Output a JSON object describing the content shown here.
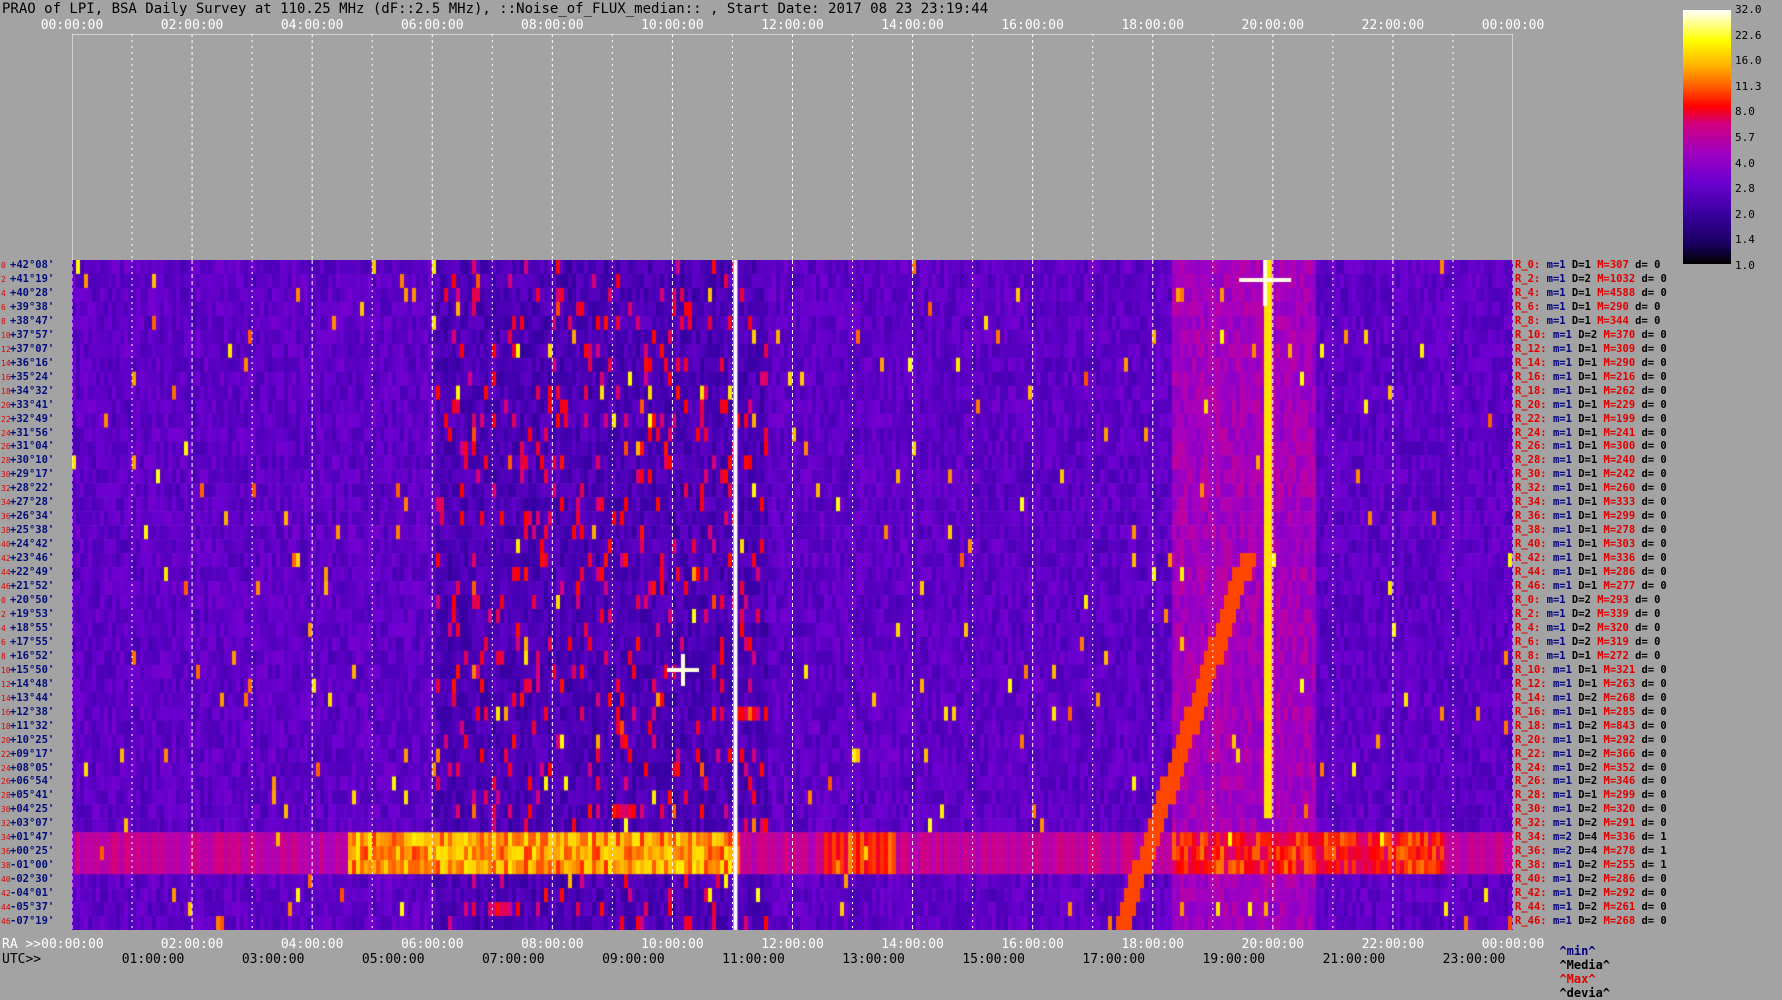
{
  "header": {
    "title": "PRAO of LPI, BSA Daily Survey at 110.25 MHz (dF::2.5 MHz), ::Noise_of_FLUX_median:: , Start Date: 2017 08 23 23:19:44"
  },
  "top_axis": {
    "ticks": [
      "00:00:00",
      "02:00:00",
      "04:00:00",
      "06:00:00",
      "08:00:00",
      "10:00:00",
      "12:00:00",
      "14:00:00",
      "16:00:00",
      "18:00:00",
      "20:00:00",
      "22:00:00",
      "00:00:00"
    ]
  },
  "bottom_axis": {
    "ra_label": "RA >>00:00:00",
    "ra_ticks": [
      "02:00:00",
      "04:00:00",
      "06:00:00",
      "08:00:00",
      "10:00:00",
      "12:00:00",
      "14:00:00",
      "16:00:00",
      "18:00:00",
      "20:00:00",
      "22:00:00",
      "00:00:00"
    ],
    "utc_label": "UTC>>",
    "utc_ticks": [
      "01:00:00",
      "03:00:00",
      "05:00:00",
      "07:00:00",
      "09:00:00",
      "11:00:00",
      "13:00:00",
      "15:00:00",
      "17:00:00",
      "19:00:00",
      "21:00:00",
      "23:00:00"
    ]
  },
  "stats_key": {
    "min": "^min^",
    "median": "^Media^",
    "max": "^Max^",
    "devia": "^devia^"
  },
  "chart_data": {
    "type": "heatmap",
    "colorbar": {
      "ticks": [
        "32.0",
        "22.6",
        "16.0",
        "11.3",
        "8.0",
        "5.7",
        "4.0",
        "2.8",
        "2.0",
        "1.4",
        "1.0"
      ],
      "colors": [
        "#000000",
        "#3a00a0",
        "#a000c0",
        "#ff0000",
        "#ffb000",
        "#ffff00",
        "#ffffff"
      ]
    },
    "declinations": [
      "+42°08'",
      "+41°19'",
      "+40°28'",
      "+39°38'",
      "+38°47'",
      "+37°57'",
      "+37°07'",
      "+36°16'",
      "+35°24'",
      "+34°32'",
      "+33°41'",
      "+32°49'",
      "+31°56'",
      "+31°04'",
      "+30°10'",
      "+29°17'",
      "+28°22'",
      "+27°28'",
      "+26°34'",
      "+25°38'",
      "+24°42'",
      "+23°46'",
      "+22°49'",
      "+21°52'",
      "+20°50'",
      "+19°53'",
      "+18°55'",
      "+17°55'",
      "+16°52'",
      "+15°50'",
      "+14°48'",
      "+13°44'",
      "+12°38'",
      "+11°32'",
      "+10°25'",
      "+09°17'",
      "+08°05'",
      "+06°54'",
      "+05°41'",
      "+04°25'",
      "+03°07'",
      "+01°47'",
      "+00°25'",
      "-01°00'",
      "-02°30'",
      "-04°01'",
      "-05°37'",
      "-07°19'"
    ],
    "beam_indices": [
      "0",
      "2",
      "4",
      "6",
      "8",
      "10",
      "12",
      "14",
      "16",
      "18",
      "20",
      "22",
      "24",
      "26",
      "28",
      "30",
      "32",
      "34",
      "36",
      "38",
      "40",
      "42",
      "44",
      "46",
      "0",
      "2",
      "4",
      "6",
      "8",
      "10",
      "12",
      "14",
      "16",
      "18",
      "20",
      "22",
      "24",
      "26",
      "28",
      "30",
      "32",
      "34",
      "36",
      "38",
      "40",
      "42",
      "44",
      "46"
    ],
    "row_stats": [
      {
        "r": "R_0:",
        "m": "m=1",
        "d": "D=1",
        "x": "M=307",
        "z": "d= 0"
      },
      {
        "r": "R_2:",
        "m": "m=1",
        "d": "D=2",
        "x": "M=1032",
        "z": "d= 0"
      },
      {
        "r": "R_4:",
        "m": "m=1",
        "d": "D=1",
        "x": "M=4588",
        "z": "d= 0"
      },
      {
        "r": "R_6:",
        "m": "m=1",
        "d": "D=1",
        "x": "M=290",
        "z": "d= 0"
      },
      {
        "r": "R_8:",
        "m": "m=1",
        "d": "D=1",
        "x": "M=344",
        "z": "d= 0"
      },
      {
        "r": "R_10:",
        "m": "m=1",
        "d": "D=2",
        "x": "M=370",
        "z": "d= 0"
      },
      {
        "r": "R_12:",
        "m": "m=1",
        "d": "D=1",
        "x": "M=309",
        "z": "d= 0"
      },
      {
        "r": "R_14:",
        "m": "m=1",
        "d": "D=1",
        "x": "M=290",
        "z": "d= 0"
      },
      {
        "r": "R_16:",
        "m": "m=1",
        "d": "D=1",
        "x": "M=216",
        "z": "d= 0"
      },
      {
        "r": "R_18:",
        "m": "m=1",
        "d": "D=1",
        "x": "M=262",
        "z": "d= 0"
      },
      {
        "r": "R_20:",
        "m": "m=1",
        "d": "D=1",
        "x": "M=229",
        "z": "d= 0"
      },
      {
        "r": "R_22:",
        "m": "m=1",
        "d": "D=1",
        "x": "M=199",
        "z": "d= 0"
      },
      {
        "r": "R_24:",
        "m": "m=1",
        "d": "D=1",
        "x": "M=241",
        "z": "d= 0"
      },
      {
        "r": "R_26:",
        "m": "m=1",
        "d": "D=1",
        "x": "M=300",
        "z": "d= 0"
      },
      {
        "r": "R_28:",
        "m": "m=1",
        "d": "D=1",
        "x": "M=240",
        "z": "d= 0"
      },
      {
        "r": "R_30:",
        "m": "m=1",
        "d": "D=1",
        "x": "M=242",
        "z": "d= 0"
      },
      {
        "r": "R_32:",
        "m": "m=1",
        "d": "D=1",
        "x": "M=260",
        "z": "d= 0"
      },
      {
        "r": "R_34:",
        "m": "m=1",
        "d": "D=1",
        "x": "M=333",
        "z": "d= 0"
      },
      {
        "r": "R_36:",
        "m": "m=1",
        "d": "D=1",
        "x": "M=299",
        "z": "d= 0"
      },
      {
        "r": "R_38:",
        "m": "m=1",
        "d": "D=1",
        "x": "M=278",
        "z": "d= 0"
      },
      {
        "r": "R_40:",
        "m": "m=1",
        "d": "D=1",
        "x": "M=303",
        "z": "d= 0"
      },
      {
        "r": "R_42:",
        "m": "m=1",
        "d": "D=1",
        "x": "M=336",
        "z": "d= 0"
      },
      {
        "r": "R_44:",
        "m": "m=1",
        "d": "D=1",
        "x": "M=286",
        "z": "d= 0"
      },
      {
        "r": "R_46:",
        "m": "m=1",
        "d": "D=1",
        "x": "M=277",
        "z": "d= 0"
      },
      {
        "r": "R_0:",
        "m": "m=1",
        "d": "D=2",
        "x": "M=293",
        "z": "d= 0"
      },
      {
        "r": "R_2:",
        "m": "m=1",
        "d": "D=2",
        "x": "M=339",
        "z": "d= 0"
      },
      {
        "r": "R_4:",
        "m": "m=1",
        "d": "D=2",
        "x": "M=320",
        "z": "d= 0"
      },
      {
        "r": "R_6:",
        "m": "m=1",
        "d": "D=2",
        "x": "M=319",
        "z": "d= 0"
      },
      {
        "r": "R_8:",
        "m": "m=1",
        "d": "D=1",
        "x": "M=272",
        "z": "d= 0"
      },
      {
        "r": "R_10:",
        "m": "m=1",
        "d": "D=1",
        "x": "M=321",
        "z": "d= 0"
      },
      {
        "r": "R_12:",
        "m": "m=1",
        "d": "D=1",
        "x": "M=263",
        "z": "d= 0"
      },
      {
        "r": "R_14:",
        "m": "m=1",
        "d": "D=2",
        "x": "M=268",
        "z": "d= 0"
      },
      {
        "r": "R_16:",
        "m": "m=1",
        "d": "D=1",
        "x": "M=285",
        "z": "d= 0"
      },
      {
        "r": "R_18:",
        "m": "m=1",
        "d": "D=2",
        "x": "M=843",
        "z": "d= 0"
      },
      {
        "r": "R_20:",
        "m": "m=1",
        "d": "D=1",
        "x": "M=292",
        "z": "d= 0"
      },
      {
        "r": "R_22:",
        "m": "m=1",
        "d": "D=2",
        "x": "M=366",
        "z": "d= 0"
      },
      {
        "r": "R_24:",
        "m": "m=1",
        "d": "D=2",
        "x": "M=352",
        "z": "d= 0"
      },
      {
        "r": "R_26:",
        "m": "m=1",
        "d": "D=2",
        "x": "M=346",
        "z": "d= 0"
      },
      {
        "r": "R_28:",
        "m": "m=1",
        "d": "D=1",
        "x": "M=299",
        "z": "d= 0"
      },
      {
        "r": "R_30:",
        "m": "m=1",
        "d": "D=2",
        "x": "M=320",
        "z": "d= 0"
      },
      {
        "r": "R_32:",
        "m": "m=1",
        "d": "D=2",
        "x": "M=291",
        "z": "d= 0"
      },
      {
        "r": "R_34:",
        "m": "m=2",
        "d": "D=4",
        "x": "M=336",
        "z": "d= 1"
      },
      {
        "r": "R_36:",
        "m": "m=2",
        "d": "D=4",
        "x": "M=278",
        "z": "d= 1"
      },
      {
        "r": "R_38:",
        "m": "m=1",
        "d": "D=2",
        "x": "M=255",
        "z": "d= 1"
      },
      {
        "r": "R_40:",
        "m": "m=1",
        "d": "D=2",
        "x": "M=286",
        "z": "d= 0"
      },
      {
        "r": "R_42:",
        "m": "m=1",
        "d": "D=2",
        "x": "M=292",
        "z": "d= 0"
      },
      {
        "r": "R_44:",
        "m": "m=1",
        "d": "D=2",
        "x": "M=261",
        "z": "d= 0"
      },
      {
        "r": "R_46:",
        "m": "m=1",
        "d": "D=2",
        "x": "M=268",
        "z": "d= 0"
      }
    ]
  }
}
